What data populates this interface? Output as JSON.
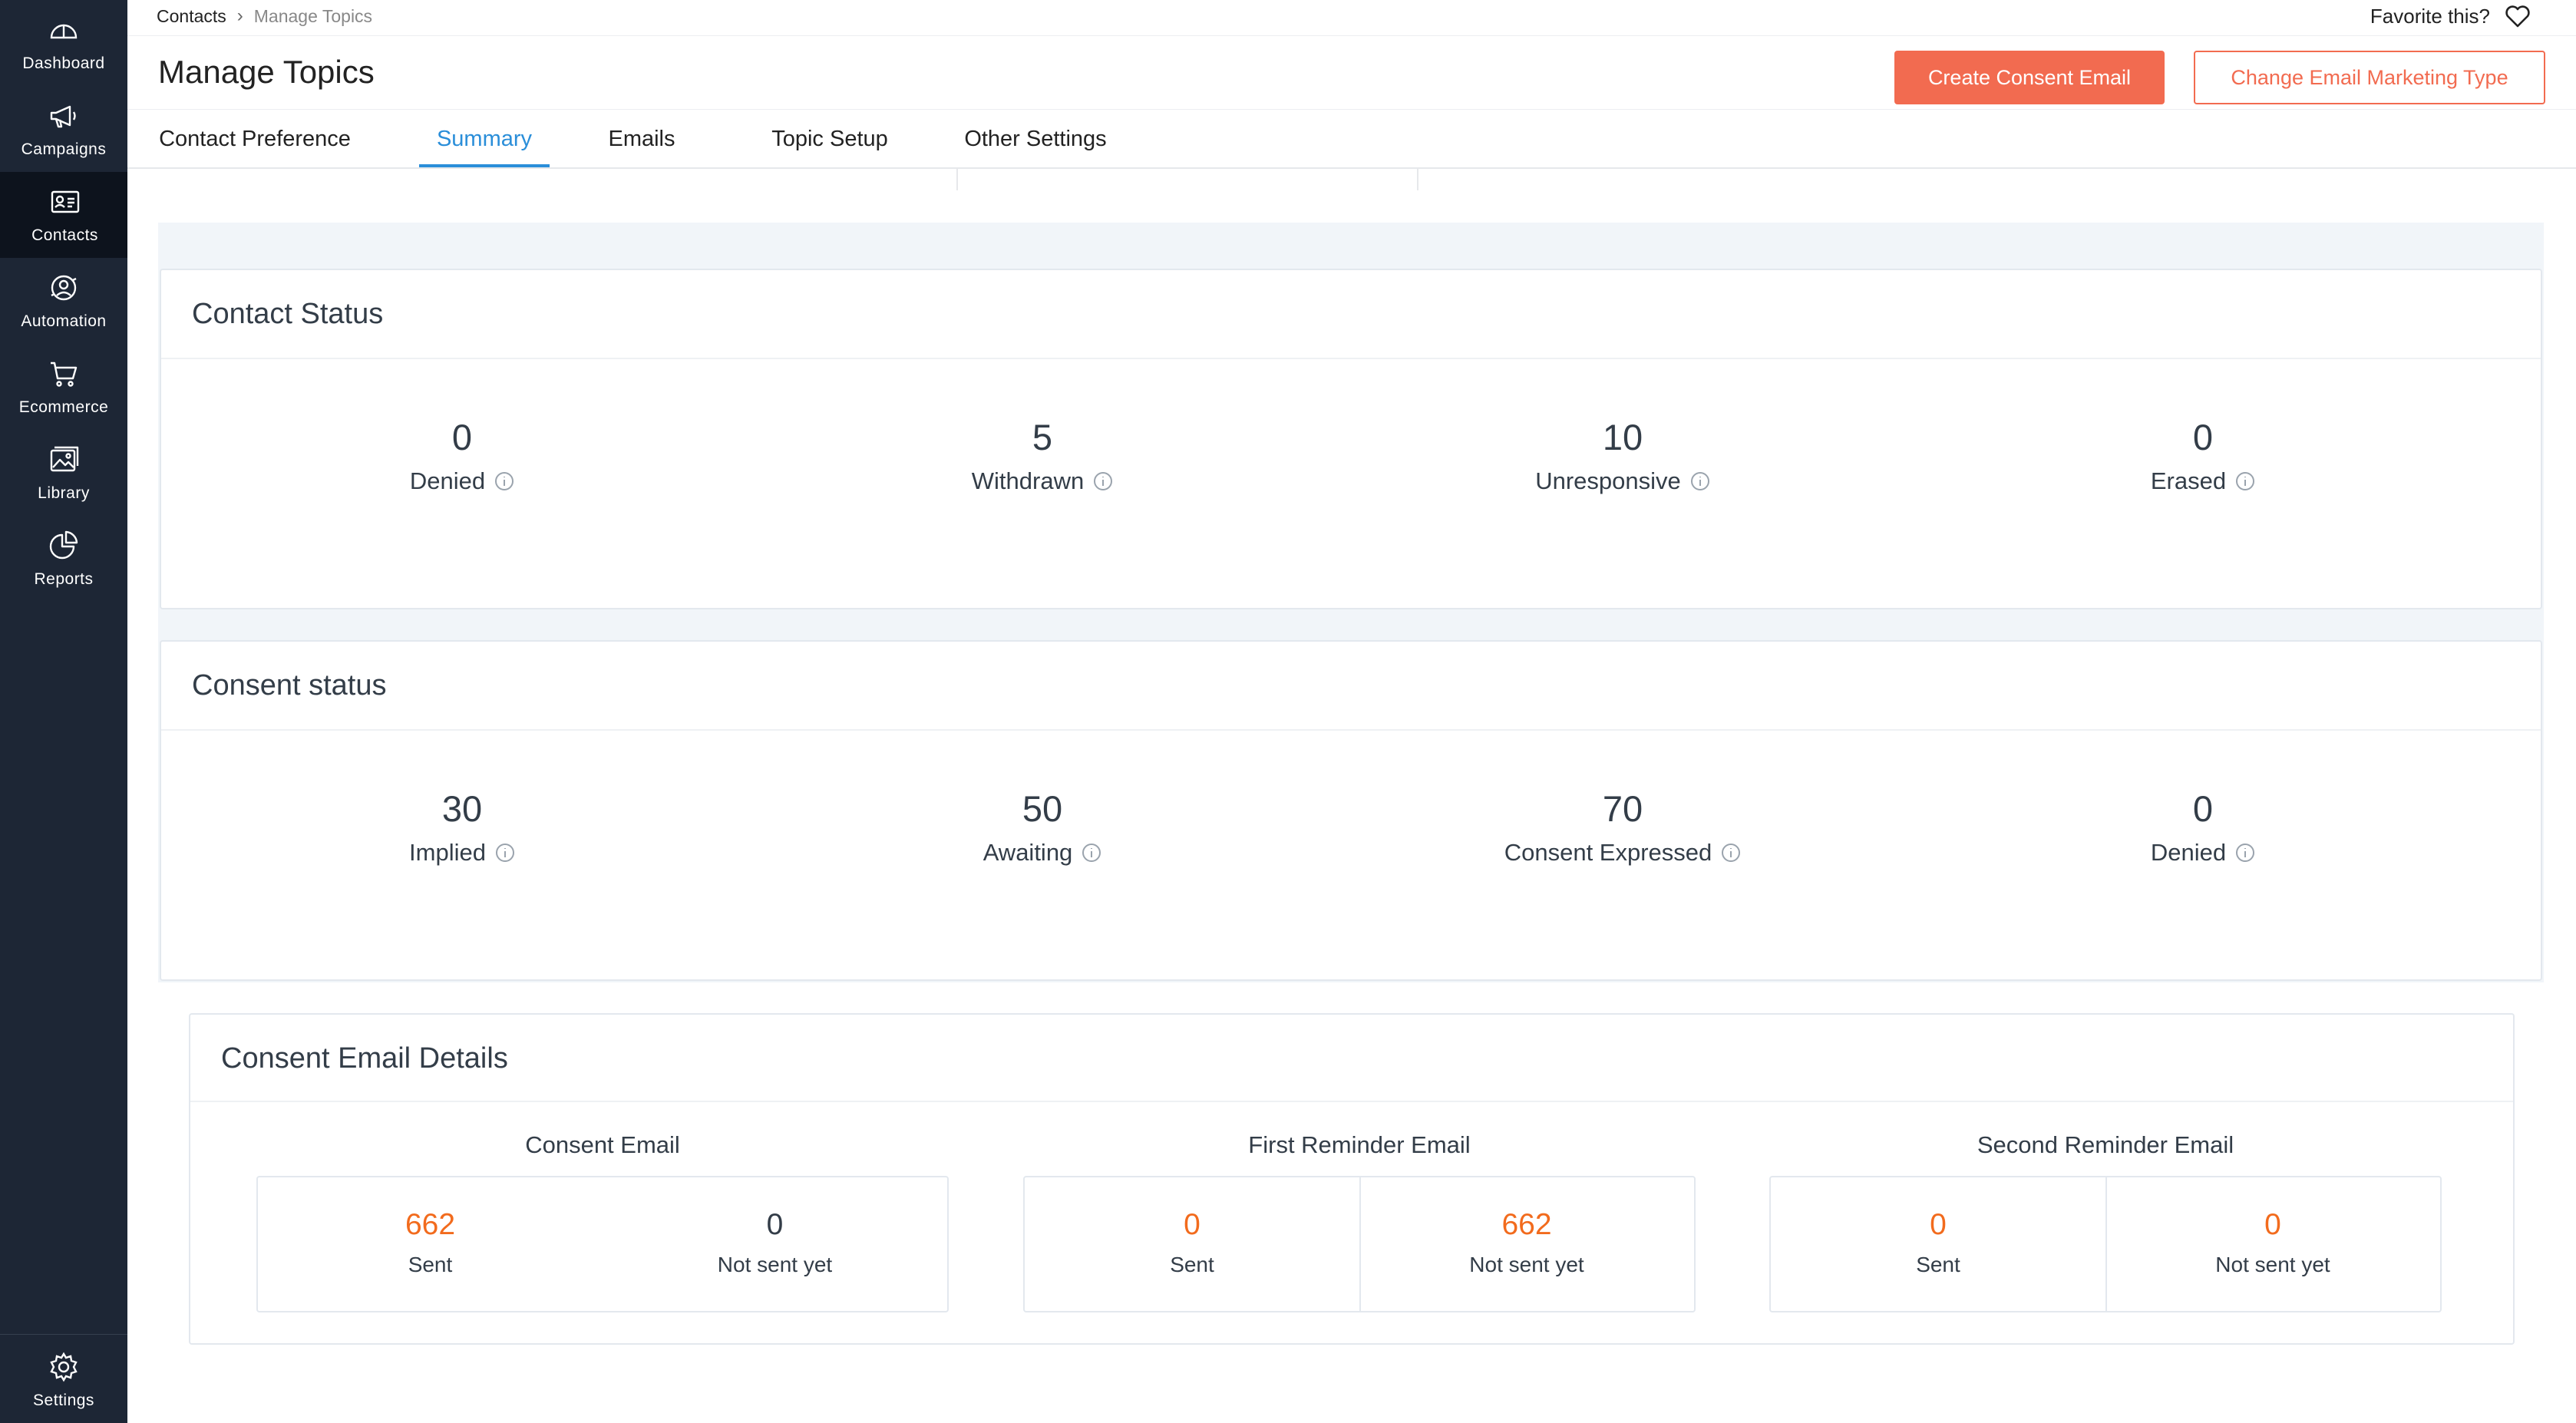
{
  "sidebar": {
    "items": [
      {
        "label": "Dashboard",
        "icon": "dashboard-icon"
      },
      {
        "label": "Campaigns",
        "icon": "megaphone-icon"
      },
      {
        "label": "Contacts",
        "icon": "contact-card-icon"
      },
      {
        "label": "Automation",
        "icon": "automation-icon"
      },
      {
        "label": "Ecommerce",
        "icon": "cart-icon"
      },
      {
        "label": "Library",
        "icon": "image-icon"
      },
      {
        "label": "Reports",
        "icon": "pie-chart-icon"
      }
    ],
    "active_index": 2,
    "settings": {
      "label": "Settings",
      "icon": "gear-icon"
    }
  },
  "breadcrumb": {
    "root": "Contacts",
    "current": "Manage Topics"
  },
  "favorite": {
    "label": "Favorite this?"
  },
  "page": {
    "title": "Manage Topics"
  },
  "actions": {
    "create_consent_email": "Create Consent Email",
    "change_email_marketing_type": "Change Email Marketing Type"
  },
  "tabs": [
    {
      "label": "Contact Preference"
    },
    {
      "label": "Summary"
    },
    {
      "label": "Emails"
    },
    {
      "label": "Topic Setup"
    },
    {
      "label": "Other Settings"
    }
  ],
  "active_tab": "Summary",
  "contact_status": {
    "title": "Contact Status",
    "stats": [
      {
        "value": "0",
        "label": "Denied"
      },
      {
        "value": "5",
        "label": "Withdrawn"
      },
      {
        "value": "10",
        "label": "Unresponsive"
      },
      {
        "value": "0",
        "label": "Erased"
      }
    ]
  },
  "consent_status": {
    "title": "Consent status",
    "stats": [
      {
        "value": "30",
        "label": "Implied"
      },
      {
        "value": "50",
        "label": "Awaiting"
      },
      {
        "value": "70",
        "label": "Consent Expressed"
      },
      {
        "value": "0",
        "label": "Denied"
      }
    ]
  },
  "consent_email_details": {
    "title": "Consent Email Details",
    "groups": [
      {
        "title": "Consent Email",
        "sent": {
          "value": "662",
          "label": "Sent"
        },
        "not_sent": {
          "value": "0",
          "label": "Not sent yet"
        }
      },
      {
        "title": "First Reminder Email",
        "sent": {
          "value": "0",
          "label": "Sent"
        },
        "not_sent": {
          "value": "662",
          "label": "Not sent yet"
        }
      },
      {
        "title": "Second Reminder Email",
        "sent": {
          "value": "0",
          "label": "Sent"
        },
        "not_sent": {
          "value": "0",
          "label": "Not sent yet"
        }
      }
    ]
  },
  "colors": {
    "sidebar_bg": "#1d2635",
    "accent_orange": "#f26b50",
    "active_tab_blue": "#2a8ed9",
    "highlight_value_orange": "#f26b1d"
  }
}
